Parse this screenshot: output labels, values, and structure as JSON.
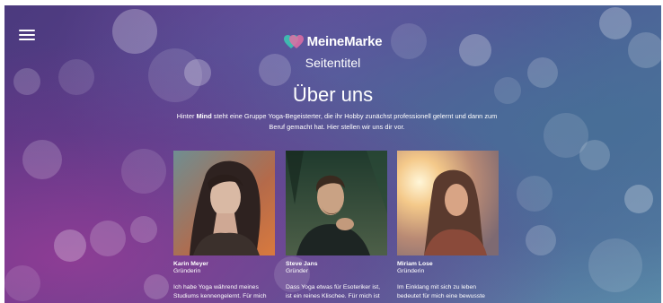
{
  "header": {
    "brand_name": "MeineMarke",
    "subtitle": "Seitentitel"
  },
  "about": {
    "heading": "Über uns",
    "intro_prefix": "Hinter ",
    "intro_bold": "Mind",
    "intro_suffix": " steht eine Gruppe Yoga-Begeisterter, die ihr Hobby zunächst professionell gelernt und dann zum Beruf gemacht hat. Hier stellen wir uns dir vor."
  },
  "team": [
    {
      "name": "Karin Meyer",
      "role": "Gründerin",
      "text": "Ich habe Yoga während meines Studiums kennengelernt. Für mich"
    },
    {
      "name": "Steve Jans",
      "role": "Gründer",
      "text": "Dass Yoga etwas für Esoteriker ist, ist ein reines Klischee. Für mich ist"
    },
    {
      "name": "Miriam Lose",
      "role": "Gründerin",
      "text": "Im Einklang mit sich zu leben bedeutet für mich eine bewusste"
    }
  ],
  "icons": {
    "menu": "hamburger-menu-icon",
    "logo": "heart-logo-icon"
  },
  "colors": {
    "text": "#ffffff",
    "logo_teal": "#3fb9b0",
    "logo_pink": "#e06fa3"
  }
}
